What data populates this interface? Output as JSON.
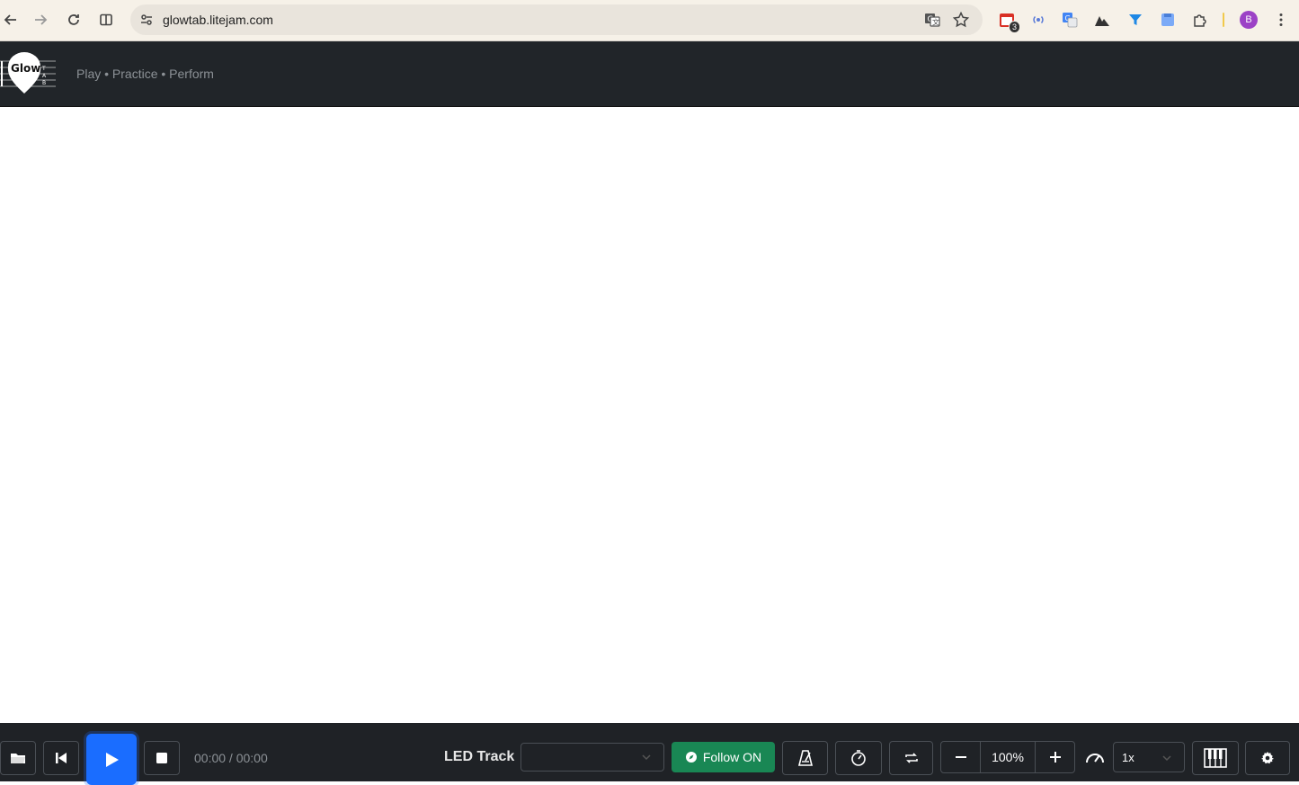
{
  "browser": {
    "url": "glowtab.litejam.com",
    "extension_badge": "3",
    "profile_initial": "B"
  },
  "app": {
    "logo_text": "Glow",
    "tagline": "Play • Practice • Perform"
  },
  "toolbar": {
    "time": "00:00 / 00:00",
    "led_track_label": "LED Track",
    "led_track_value": "",
    "follow_label": "Follow ON",
    "zoom": "100%",
    "speed": "1x"
  },
  "colors": {
    "play": "#1a6dff",
    "follow": "#198754",
    "header": "#212529",
    "toolbar": "#1f2226"
  }
}
